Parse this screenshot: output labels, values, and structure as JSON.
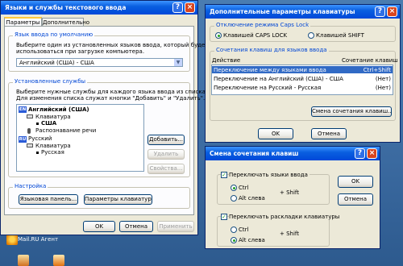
{
  "colors": {
    "title_bar": "#0054e3",
    "selection": "#316ac5",
    "highlight_text": "#ffffff"
  },
  "main": {
    "title": "Языки и службы текстового ввода",
    "tabs": [
      "Параметры",
      "Дополнительно"
    ],
    "default_lang": {
      "label": "Язык ввода по умолчанию",
      "desc1": "Выберите один из установленных языков ввода, который будет",
      "desc2": "использоваться при загрузке компьютера.",
      "value": "Английский (США) - США"
    },
    "services": {
      "label": "Установленные службы",
      "desc1": "Выберите нужные службы для каждого языка ввода из списка.",
      "desc2": "Для изменения списка служат кнопки \"Добавить\" и \"Удалить\".",
      "en_badge": "EN",
      "ru_badge": "RU",
      "tree": {
        "en": "Английский (США)",
        "keyboard1": "Клавиатура",
        "usa": "США",
        "speech": "Распознавание речи",
        "ru": "Русский",
        "keyboard2": "Клавиатура",
        "russian": "Русская"
      },
      "add": "Добавить...",
      "remove": "Удалить",
      "properties": "Свойства..."
    },
    "settings": {
      "label": "Настройка",
      "lang_bar": "Языковая панель...",
      "key_settings": "Параметры клавиатуры..."
    },
    "ok": "OK",
    "cancel": "Отмена",
    "apply": "Применить"
  },
  "adv": {
    "title": "Дополнительные параметры клавиатуры",
    "caps_label": "Отключение режима Caps Lock",
    "caps_lock": "Клавишей CAPS LOCK",
    "shift": "Клавишей SHIFT",
    "hotkeys_label": "Сочетания клавиш для языков ввода",
    "col_action": "Действие",
    "col_combo": "Сочетание клавиш",
    "rows": [
      {
        "action": "Переключение между языками ввода",
        "combo": "Ctrl+Shift"
      },
      {
        "action": "Переключение на Английский (США) - США",
        "combo": "(Нет)"
      },
      {
        "action": "Переключение на Русский - Русская",
        "combo": "(Нет)"
      }
    ],
    "change_btn": "Смена сочетания клавиш...",
    "ok": "OK",
    "cancel": "Отмена"
  },
  "combo": {
    "title": "Смена сочетания клавиш",
    "switch_lang": "Переключать языки ввода",
    "ctrl": "Ctrl",
    "shift": "+ Shift",
    "alt_left": "Alt слева",
    "switch_layout": "Переключать раскладки клавиатуры",
    "ctrl2": "Ctrl",
    "shift2": "+ Shift",
    "alt_left2": "Alt слева",
    "ok": "OK",
    "cancel": "Отмена"
  },
  "desktop": {
    "mail_label": "Mail.RU Агент"
  }
}
